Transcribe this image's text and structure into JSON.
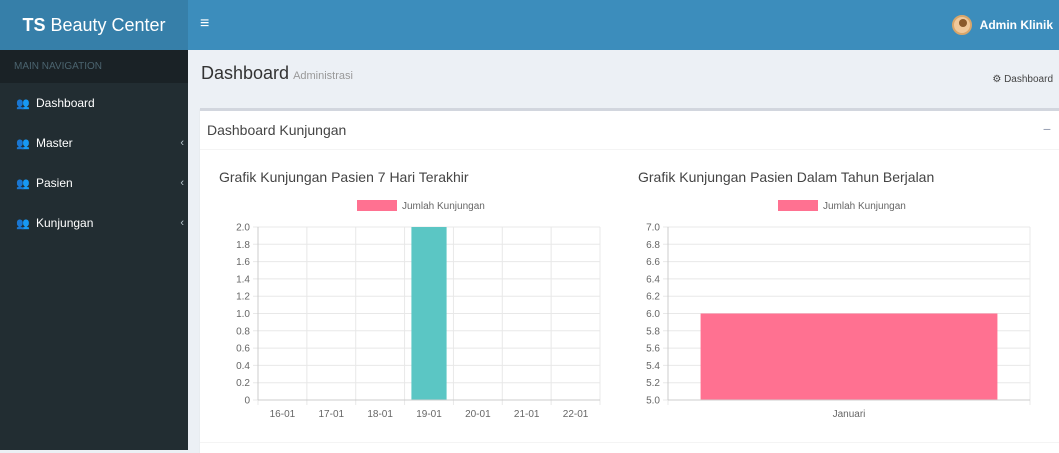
{
  "header": {
    "brand_bold": "TS",
    "brand_rest": " Beauty Center",
    "user_name": "Admin Klinik"
  },
  "sidebar": {
    "header": "MAIN NAVIGATION",
    "items": [
      {
        "label": "Dashboard",
        "has_submenu": false
      },
      {
        "label": "Master",
        "has_submenu": true
      },
      {
        "label": "Pasien",
        "has_submenu": true
      },
      {
        "label": "Kunjungan",
        "has_submenu": true
      }
    ]
  },
  "page": {
    "title": "Dashboard",
    "subtitle": "Administrasi",
    "breadcrumb": "Dashboard"
  },
  "box": {
    "title": "Dashboard Kunjungan",
    "collapse_symbol": "−"
  },
  "chart_data": [
    {
      "type": "bar",
      "title": "Grafik Kunjungan Pasien 7 Hari Terakhir",
      "categories": [
        "16-01",
        "17-01",
        "18-01",
        "19-01",
        "20-01",
        "21-01",
        "22-01"
      ],
      "series": [
        {
          "name": "Jumlah Kunjungan",
          "values": [
            0,
            0,
            0,
            2,
            0,
            0,
            0
          ]
        }
      ],
      "bar_color": "#5bc6c4",
      "legend_color": "#ff7191",
      "ylim": [
        0,
        2
      ],
      "yticks": [
        "2.0",
        "1.8",
        "1.6",
        "1.4",
        "1.2",
        "1.0",
        "0.8",
        "0.6",
        "0.4",
        "0.2",
        "0"
      ],
      "legend": "top-center",
      "grid": true
    },
    {
      "type": "bar",
      "title": "Grafik Kunjungan Pasien Dalam Tahun Berjalan",
      "categories": [
        "Januari"
      ],
      "series": [
        {
          "name": "Jumlah Kunjungan",
          "values": [
            6
          ]
        }
      ],
      "bar_color": "#ff7191",
      "legend_color": "#ff7191",
      "ylim": [
        5,
        7
      ],
      "yticks": [
        "7.0",
        "6.8",
        "6.6",
        "6.4",
        "6.2",
        "6.0",
        "5.8",
        "5.6",
        "5.4",
        "5.2",
        "5.0"
      ],
      "legend": "top-center",
      "grid": true
    }
  ]
}
